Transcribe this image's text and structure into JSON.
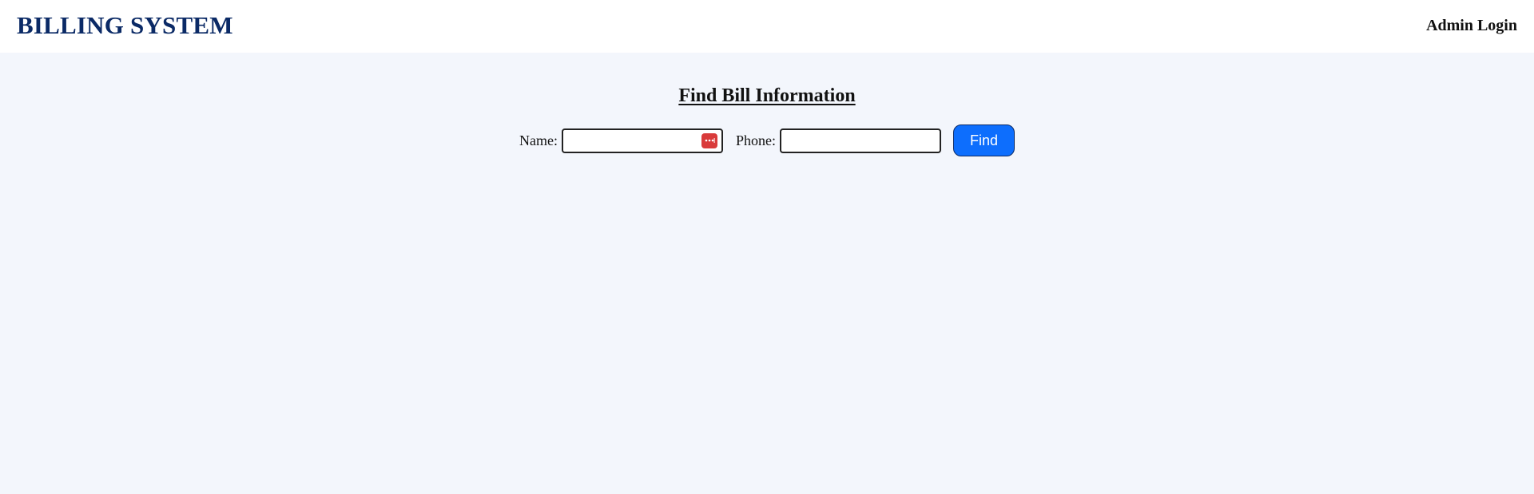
{
  "header": {
    "brand": "BILLING SYSTEM",
    "admin_login": "Admin Login"
  },
  "main": {
    "title": "Find Bill Information",
    "form": {
      "name_label": "Name:",
      "name_value": "",
      "phone_label": "Phone:",
      "phone_value": "",
      "find_label": "Find"
    }
  },
  "colors": {
    "brand": "#0b2a66",
    "background": "#f3f6fc",
    "button": "#0d6efd",
    "autofill_icon": "#d93b3b"
  },
  "icons": {
    "name_field_icon": "password-manager-icon"
  }
}
